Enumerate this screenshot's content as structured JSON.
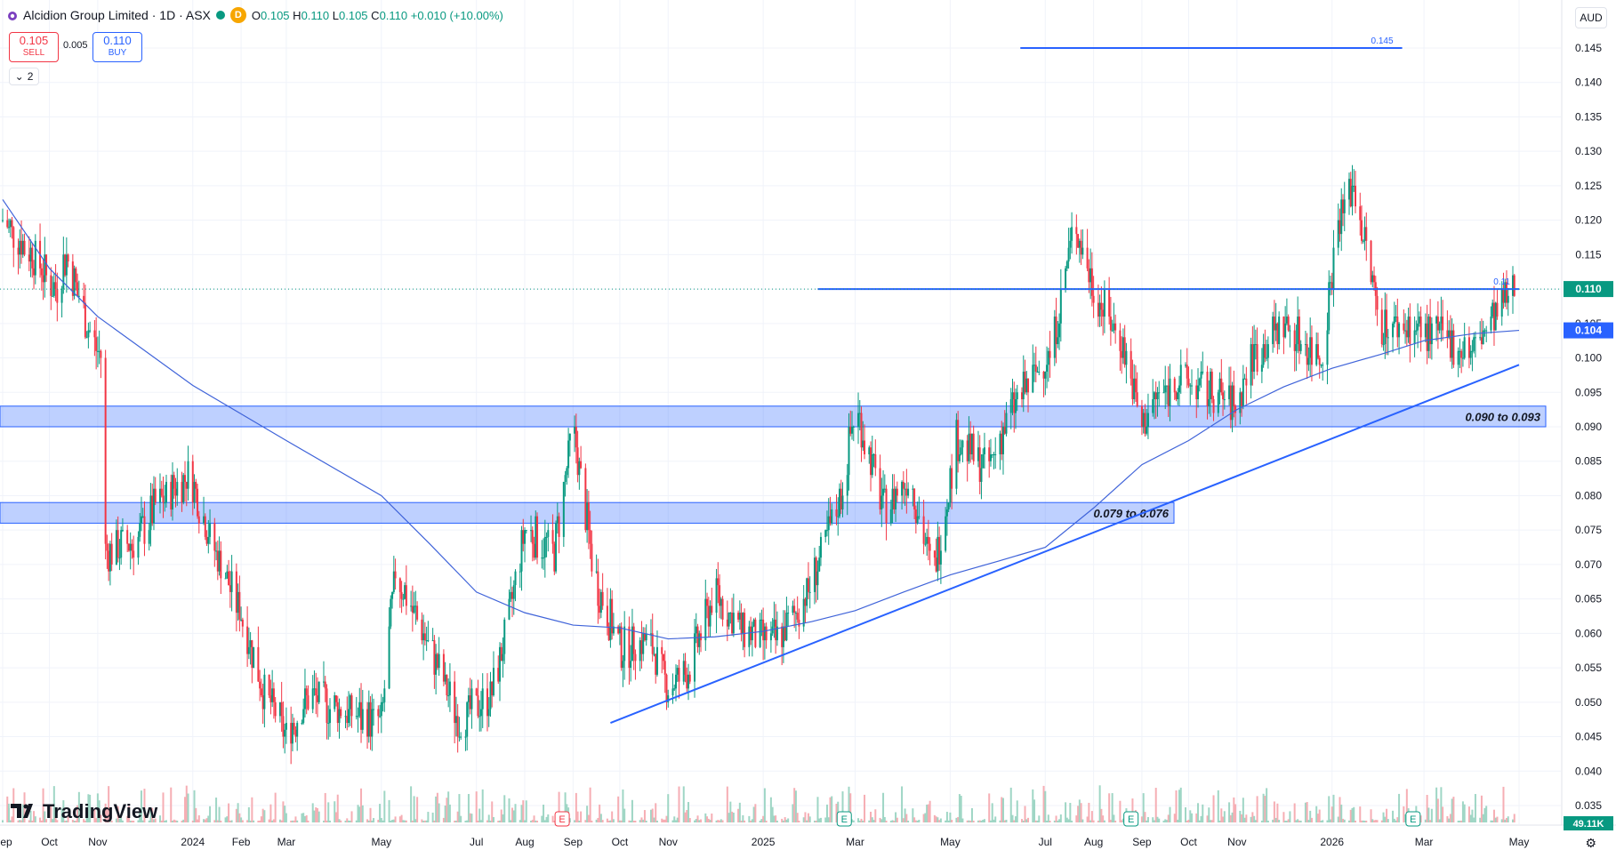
{
  "header": {
    "title": "Alcidion Group Limited · 1D · ASX",
    "market_badge": "D",
    "ohlc": {
      "o_label": "O",
      "o": "0.105",
      "h_label": "H",
      "h": "0.110",
      "l_label": "L",
      "l": "0.105",
      "c_label": "C",
      "c": "0.110",
      "change": "+0.010 (+10.00%)"
    }
  },
  "trade": {
    "sell_price": "0.105",
    "sell_label": "SELL",
    "spread": "0.005",
    "buy_price": "0.110",
    "buy_label": "BUY"
  },
  "indicators_toggle": {
    "count": "2"
  },
  "currency": "AUD",
  "brand": "TradingView",
  "colors": {
    "up": "#089981",
    "down": "#f23645",
    "line": "#2962ff",
    "ma": "#3f63d9",
    "zone_fill": "#2962ff",
    "volume_up": "#9fd6c5",
    "volume_down": "#f6aeb4"
  },
  "chart_data": {
    "type": "candlestick",
    "symbol": "Alcidion Group Limited",
    "interval": "1D",
    "exchange": "ASX",
    "y_axis": {
      "min": 0.035,
      "max": 0.145,
      "ticks": [
        "0.145",
        "0.140",
        "0.135",
        "0.130",
        "0.125",
        "0.120",
        "0.115",
        "0.110",
        "0.105",
        "0.100",
        "0.095",
        "0.090",
        "0.085",
        "0.080",
        "0.075",
        "0.070",
        "0.065",
        "0.060",
        "0.055",
        "0.050",
        "0.045",
        "0.040",
        "0.035"
      ]
    },
    "x_axis": {
      "ticks": [
        {
          "label": "Sep",
          "date": "2023-09-01"
        },
        {
          "label": "Oct",
          "date": "2023-10-01"
        },
        {
          "label": "Nov",
          "date": "2023-11-01"
        },
        {
          "label": "2024",
          "date": "2024-01-01"
        },
        {
          "label": "Feb",
          "date": "2024-02-01"
        },
        {
          "label": "Mar",
          "date": "2024-03-01"
        },
        {
          "label": "May",
          "date": "2024-05-01"
        },
        {
          "label": "Jul",
          "date": "2024-07-01"
        },
        {
          "label": "Aug",
          "date": "2024-08-01"
        },
        {
          "label": "Sep",
          "date": "2024-09-01"
        },
        {
          "label": "Oct",
          "date": "2024-10-01"
        },
        {
          "label": "Nov",
          "date": "2024-11-01"
        },
        {
          "label": "2025",
          "date": "2025-01-01"
        },
        {
          "label": "Mar",
          "date": "2025-03-01"
        },
        {
          "label": "May",
          "date": "2025-05-01"
        },
        {
          "label": "Jul",
          "date": "2025-07-01"
        },
        {
          "label": "Aug",
          "date": "2025-08-01"
        },
        {
          "label": "Sep",
          "date": "2025-09-01"
        },
        {
          "label": "Oct",
          "date": "2025-10-01"
        },
        {
          "label": "Nov",
          "date": "2025-11-01"
        },
        {
          "label": "2026",
          "date": "2026-01-01"
        },
        {
          "label": "Mar",
          "date": "2026-03-01"
        },
        {
          "label": "May",
          "date": "2026-05-01"
        }
      ]
    },
    "last_price": {
      "value": 0.11,
      "label": "0.110"
    },
    "moving_average": {
      "last_value": 0.104,
      "label": "0.104",
      "points": [
        [
          "2023-09-01",
          0.123
        ],
        [
          "2023-10-01",
          0.113
        ],
        [
          "2023-11-01",
          0.106
        ],
        [
          "2024-01-01",
          0.096
        ],
        [
          "2024-03-01",
          0.088
        ],
        [
          "2024-05-01",
          0.08
        ],
        [
          "2024-06-01",
          0.073
        ],
        [
          "2024-07-01",
          0.066
        ],
        [
          "2024-08-01",
          0.063
        ],
        [
          "2024-09-01",
          0.0612
        ],
        [
          "2024-10-01",
          0.0608
        ],
        [
          "2024-11-01",
          0.0592
        ],
        [
          "2024-12-01",
          0.0595
        ],
        [
          "2025-01-01",
          0.0603
        ],
        [
          "2025-02-01",
          0.0617
        ],
        [
          "2025-03-01",
          0.0633
        ],
        [
          "2025-04-01",
          0.066
        ],
        [
          "2025-05-01",
          0.0685
        ],
        [
          "2025-06-01",
          0.0705
        ],
        [
          "2025-07-01",
          0.0725
        ],
        [
          "2025-08-01",
          0.0782
        ],
        [
          "2025-09-01",
          0.0845
        ],
        [
          "2025-10-01",
          0.088
        ],
        [
          "2025-11-01",
          0.0925
        ],
        [
          "2025-12-01",
          0.0958
        ],
        [
          "2026-01-01",
          0.0985
        ],
        [
          "2026-02-01",
          0.1005
        ],
        [
          "2026-03-01",
          0.1025
        ],
        [
          "2026-04-01",
          0.1035
        ],
        [
          "2026-05-01",
          0.104
        ]
      ]
    },
    "ohlc_anchors": [
      [
        "2023-09-01",
        0.12
      ],
      [
        "2023-09-20",
        0.115
      ],
      [
        "2023-10-05",
        0.11
      ],
      [
        "2023-10-12",
        0.115
      ],
      [
        "2023-10-25",
        0.105
      ],
      [
        "2023-11-03",
        0.1
      ],
      [
        "2023-11-06",
        0.072
      ],
      [
        "2023-11-25",
        0.073
      ],
      [
        "2023-12-10",
        0.079
      ],
      [
        "2023-12-30",
        0.083
      ],
      [
        "2024-01-15",
        0.072
      ],
      [
        "2024-02-01",
        0.063
      ],
      [
        "2024-02-15",
        0.052
      ],
      [
        "2024-03-01",
        0.045
      ],
      [
        "2024-03-15",
        0.051
      ],
      [
        "2024-04-15",
        0.048
      ],
      [
        "2024-05-01",
        0.047
      ],
      [
        "2024-05-10",
        0.069
      ],
      [
        "2024-06-01",
        0.058
      ],
      [
        "2024-06-20",
        0.047
      ],
      [
        "2024-07-10",
        0.051
      ],
      [
        "2024-07-20",
        0.06
      ],
      [
        "2024-08-01",
        0.075
      ],
      [
        "2024-08-20",
        0.072
      ],
      [
        "2024-09-01",
        0.09
      ],
      [
        "2024-09-15",
        0.068
      ],
      [
        "2024-10-01",
        0.058
      ],
      [
        "2024-10-20",
        0.059
      ],
      [
        "2024-11-01",
        0.052
      ],
      [
        "2024-11-15",
        0.055
      ],
      [
        "2024-12-01",
        0.066
      ],
      [
        "2024-12-20",
        0.06
      ],
      [
        "2025-01-10",
        0.059
      ],
      [
        "2025-02-01",
        0.067
      ],
      [
        "2025-02-20",
        0.08
      ],
      [
        "2025-03-01",
        0.093
      ],
      [
        "2025-03-20",
        0.078
      ],
      [
        "2025-04-05",
        0.083
      ],
      [
        "2025-04-20",
        0.068
      ],
      [
        "2025-05-05",
        0.088
      ],
      [
        "2025-05-25",
        0.084
      ],
      [
        "2025-06-10",
        0.093
      ],
      [
        "2025-07-05",
        0.101
      ],
      [
        "2025-07-20",
        0.12
      ],
      [
        "2025-08-01",
        0.11
      ],
      [
        "2025-08-20",
        0.102
      ],
      [
        "2025-09-01",
        0.09
      ],
      [
        "2025-09-10",
        0.094
      ],
      [
        "2025-09-25",
        0.097
      ],
      [
        "2025-10-15",
        0.095
      ],
      [
        "2025-11-01",
        0.093
      ],
      [
        "2025-11-10",
        0.1
      ],
      [
        "2025-12-01",
        0.105
      ],
      [
        "2025-12-25",
        0.1
      ],
      [
        "2026-01-05",
        0.12
      ],
      [
        "2026-01-15",
        0.125
      ],
      [
        "2026-02-01",
        0.105
      ],
      [
        "2026-03-01",
        0.104
      ],
      [
        "2026-04-01",
        0.101
      ],
      [
        "2026-04-28",
        0.11
      ]
    ],
    "volume": {
      "last_label": "49.11K"
    },
    "annotations": [
      {
        "type": "horizontal_line",
        "price": 0.145,
        "label": "0.145",
        "from": "2025-06-15",
        "to": "2026-02-15"
      },
      {
        "type": "horizontal_line",
        "price": 0.11,
        "label": "0.11",
        "from": "2025-02-05",
        "to": "2026-05-01"
      },
      {
        "type": "zone",
        "low": 0.09,
        "high": 0.093,
        "label": "0.090 to 0.093"
      },
      {
        "type": "zone",
        "low": 0.076,
        "high": 0.079,
        "label": "0.079 to 0.076"
      },
      {
        "type": "trend_line",
        "from": [
          "2024-09-25",
          0.047
        ],
        "to": [
          "2026-05-01",
          0.099
        ]
      }
    ],
    "earnings_markers": [
      "2024-08-25",
      "2025-02-22",
      "2025-08-25",
      "2026-02-22"
    ],
    "earnings_label": "E"
  }
}
